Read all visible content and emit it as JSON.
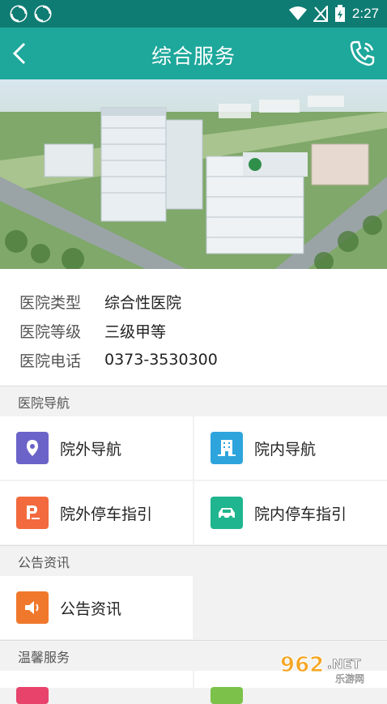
{
  "status_bar": {
    "time": "2:27"
  },
  "header": {
    "title": "综合服务"
  },
  "hospital": {
    "rows": [
      {
        "key": "医院类型",
        "value": "综合性医院"
      },
      {
        "key": "医院等级",
        "value": "三级甲等"
      },
      {
        "key": "医院电话",
        "value": "0373-3530300"
      }
    ]
  },
  "sections": {
    "navigation": {
      "title": "医院导航",
      "items": [
        {
          "label": "院外导航",
          "icon": "location-pin-icon",
          "color": "#6c63c9"
        },
        {
          "label": "院内导航",
          "icon": "building-icon",
          "color": "#2ea4dc"
        },
        {
          "label": "院外停车指引",
          "icon": "parking-icon",
          "color": "#f26a3d"
        },
        {
          "label": "院内停车指引",
          "icon": "car-icon",
          "color": "#1fb58f"
        }
      ]
    },
    "news": {
      "title": "公告资讯",
      "items": [
        {
          "label": "公告资讯",
          "icon": "speaker-icon",
          "color": "#f0782c"
        }
      ]
    },
    "care": {
      "title": "温馨服务"
    }
  },
  "watermark": {
    "text": "962.NET",
    "subtext": "乐游网"
  }
}
